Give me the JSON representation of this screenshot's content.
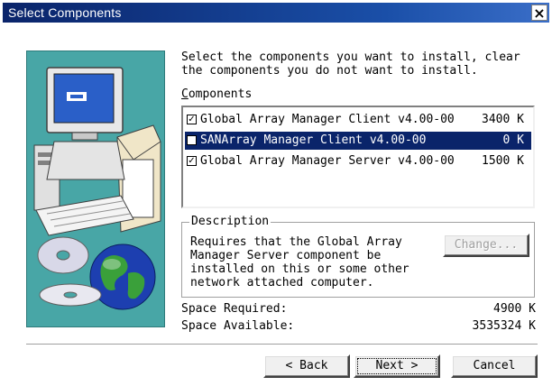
{
  "window": {
    "title": "Select Components",
    "close_glyph": "×"
  },
  "intro": "Select the components you want to install, clear\nthe components you do not want to install.",
  "components_label": "Components",
  "components_label_hotkey": "C",
  "components_label_rest": "omponents",
  "components": [
    {
      "name": "Global Array Manager Client v4.00-00",
      "size": "3400 K",
      "checked": true,
      "selected": false
    },
    {
      "name": "SANArray Manager Client v4.00-00",
      "size": "0 K",
      "checked": false,
      "selected": true
    },
    {
      "name": "Global Array Manager Server v4.00-00",
      "size": "1500 K",
      "checked": true,
      "selected": false
    }
  ],
  "description": {
    "legend": "Description",
    "text": "Requires that the Global Array\nManager Server component be\ninstalled on this or some other\nnetwork attached computer.",
    "change_button": "Change..."
  },
  "space": {
    "required_label": "Space Required:",
    "required_value": "4900 K",
    "available_label": "Space Available:",
    "available_value": "3535324 K"
  },
  "buttons": {
    "back": {
      "label": "< Back",
      "hotkey": "B"
    },
    "next": {
      "label": "Next >",
      "hotkey": "N"
    },
    "cancel": {
      "label": "Cancel"
    }
  },
  "icons": [
    "computer-illustration",
    "globe-icon",
    "cd-disc-icon",
    "checkbox-checked-icon",
    "checkbox-unchecked-icon",
    "close-icon"
  ],
  "colors": {
    "title_bar": "#0a246a",
    "art_background": "#48a6a6",
    "selection": "#0a246a"
  }
}
